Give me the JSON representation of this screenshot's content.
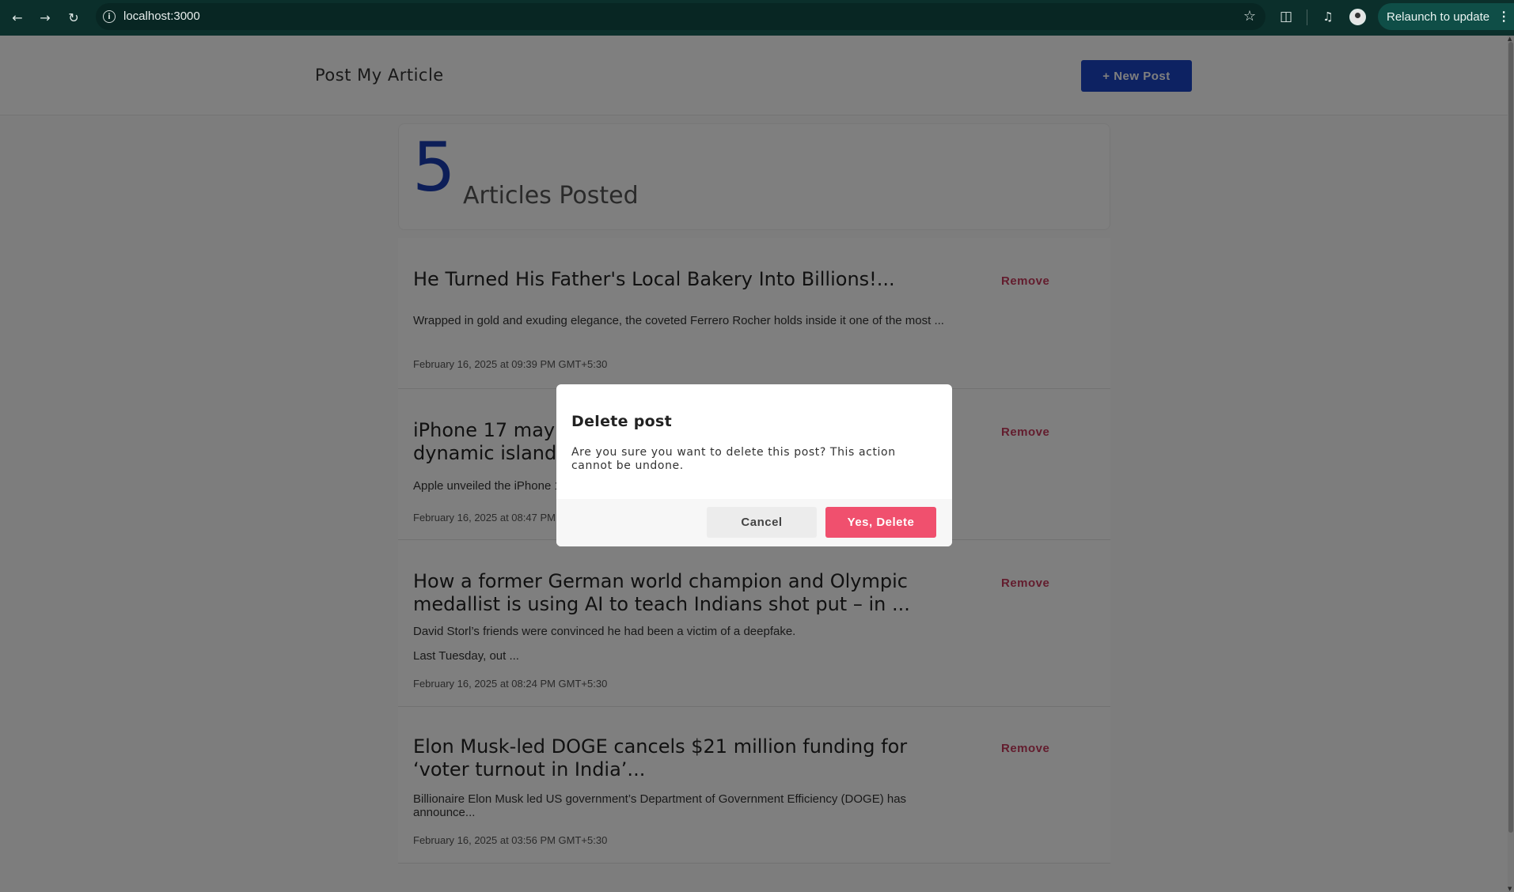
{
  "browser": {
    "url": "localhost:3000",
    "relaunch_label": "Relaunch to update",
    "icons": [
      "back-arrow-icon",
      "forward-arrow-icon",
      "reload-icon",
      "site-info-icon",
      "bookmark-star-icon",
      "extensions-icon",
      "media-control-icon",
      "profile-avatar"
    ]
  },
  "header": {
    "brand": "Post My Article",
    "new_post_label": "+ New Post"
  },
  "stats": {
    "count": "5",
    "label": "Articles Posted"
  },
  "remove_label": "Remove",
  "articles": [
    {
      "title": "He Turned His Father's Local Bakery Into Billions!...",
      "excerpt": "Wrapped in gold and exuding elegance, the coveted Ferrero Rocher holds inside it one of the most ...",
      "date": "February 16, 2025 at 09:39 PM GMT+5:30"
    },
    {
      "title": "iPhone 17 may l",
      "title_line2": "dynamic island",
      "excerpt": "Apple unveiled the iPhone 1",
      "date": "February 16, 2025 at 08:47 PM"
    },
    {
      "title": "How a former German world champion and Olympic medallist is using AI to teach Indians shot put – in ...",
      "excerpt": "David Storl’s friends were convinced he had been a victim of a deepfake.",
      "excerpt2": "Last Tuesday, out ...",
      "date": "February 16, 2025 at 08:24 PM GMT+5:30"
    },
    {
      "title": "Elon Musk-led DOGE cancels $21 million funding for ‘voter turnout in India’...",
      "excerpt": "Billionaire Elon Musk led US government’s Department of Government Efficiency (DOGE) has announce...",
      "date": "February 16, 2025 at 03:56 PM GMT+5:30"
    }
  ],
  "dialog": {
    "title": "Delete post",
    "message": "Are you sure you want to delete this post? This action cannot be undone.",
    "cancel_label": "Cancel",
    "confirm_label": "Yes, Delete"
  },
  "colors": {
    "chrome_bg": "#0b2f2b",
    "primary": "#1a44c4",
    "danger": "#f0506e",
    "remove_text": "#c63b5c",
    "overlay": "rgba(0,0,0,0.5)"
  }
}
